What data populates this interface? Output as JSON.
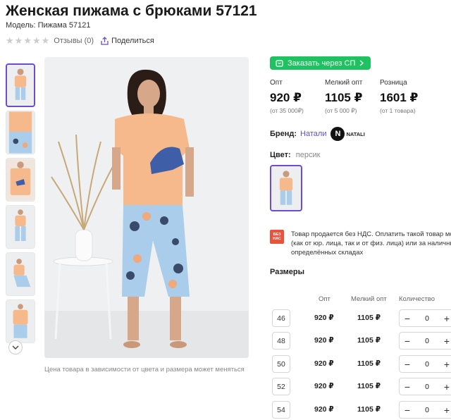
{
  "product": {
    "title": "Женская пижама с брюками 57121",
    "model_label": "Модель:",
    "model_value": "Пижама 57121",
    "reviews": "Отзывы (0)",
    "share": "Поделиться"
  },
  "gallery": {
    "note": "Цена товара в зависимости от цвета и размера может меняться",
    "thumb_count": 6
  },
  "order": {
    "sp_button": "Заказать через СП"
  },
  "prices": [
    {
      "label": "Опт",
      "value": "920 ₽",
      "sub": "(от 35 000₽)"
    },
    {
      "label": "Мелкий опт",
      "value": "1105 ₽",
      "sub": "(от 5 000 ₽)"
    },
    {
      "label": "Розница",
      "value": "1601 ₽",
      "sub": "(от 1 товара)"
    }
  ],
  "brand": {
    "label": "Бренд:",
    "name": "Натали",
    "logo_text": "NATALI"
  },
  "color": {
    "label": "Цвет:",
    "value": "персик"
  },
  "vat": {
    "badge": "БЕЗ НАС",
    "line1": "Товар продается без НДС. Оплатить такой товар мо",
    "line2": "(как от юр. лица, так и от физ. лица) или за наличны",
    "line3": "определённых складах"
  },
  "sizes": {
    "title": "Размеры",
    "headers": [
      "Опт",
      "Мелкий опт",
      "Количество"
    ],
    "rows": [
      {
        "size": "46",
        "opt": "920 ₽",
        "small_opt": "1105 ₽",
        "qty": "0"
      },
      {
        "size": "48",
        "opt": "920 ₽",
        "small_opt": "1105 ₽",
        "qty": "0"
      },
      {
        "size": "50",
        "opt": "920 ₽",
        "small_opt": "1105 ₽",
        "qty": "0"
      },
      {
        "size": "52",
        "opt": "920 ₽",
        "small_opt": "1105 ₽",
        "qty": "0"
      },
      {
        "size": "54",
        "opt": "920 ₽",
        "small_opt": "1105 ₽",
        "qty": "0"
      }
    ],
    "minus": "−",
    "plus": "+"
  },
  "colors": {
    "accent": "#6c4bd8",
    "green": "#20c160",
    "link": "#5a50d6",
    "vat_badge": "#e8533b",
    "shirt": "#f6b98c",
    "pants": "#a9cdea"
  }
}
